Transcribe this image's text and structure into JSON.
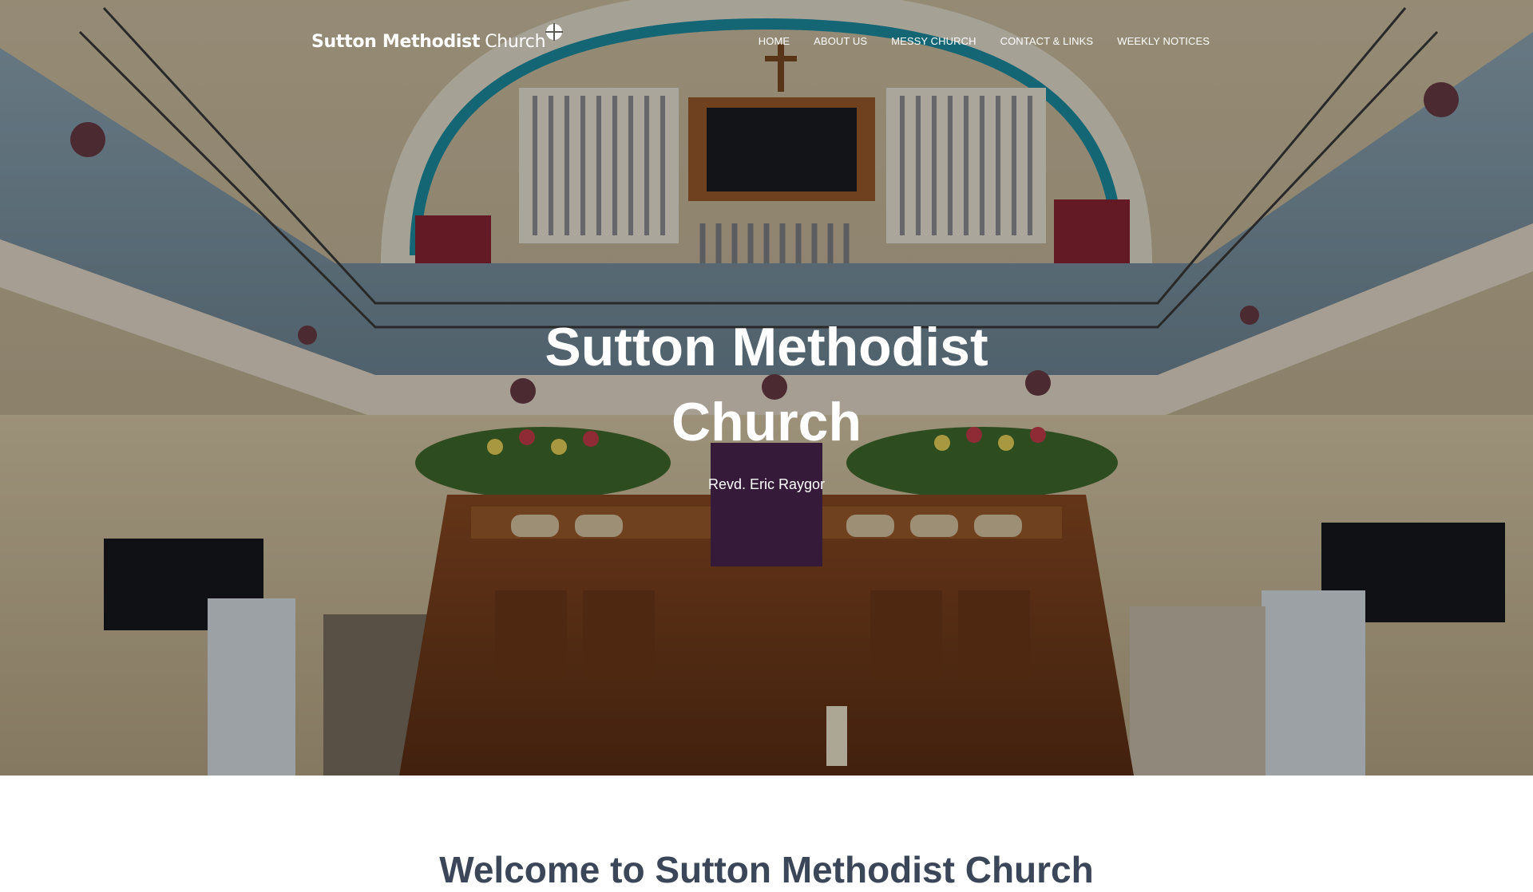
{
  "header": {
    "logo_bold": "Sutton Methodist",
    "logo_light": "Church",
    "logo_icon": "methodist-orb-cross-icon"
  },
  "nav": {
    "items": [
      {
        "label": "HOME"
      },
      {
        "label": "ABOUT US"
      },
      {
        "label": "MESSY CHURCH"
      },
      {
        "label": "CONTACT & LINKS"
      },
      {
        "label": "WEEKLY NOTICES"
      }
    ]
  },
  "hero": {
    "title": "Sutton Methodist Church",
    "subtitle": "Revd. Eric Raygor"
  },
  "main": {
    "welcome_heading": "Welcome to Sutton Methodist Church"
  },
  "colors": {
    "hero_text": "#ffffff",
    "heading_text": "#3b4758",
    "teal_arch": "#1c8ea3",
    "curtain": "#8a2434"
  }
}
